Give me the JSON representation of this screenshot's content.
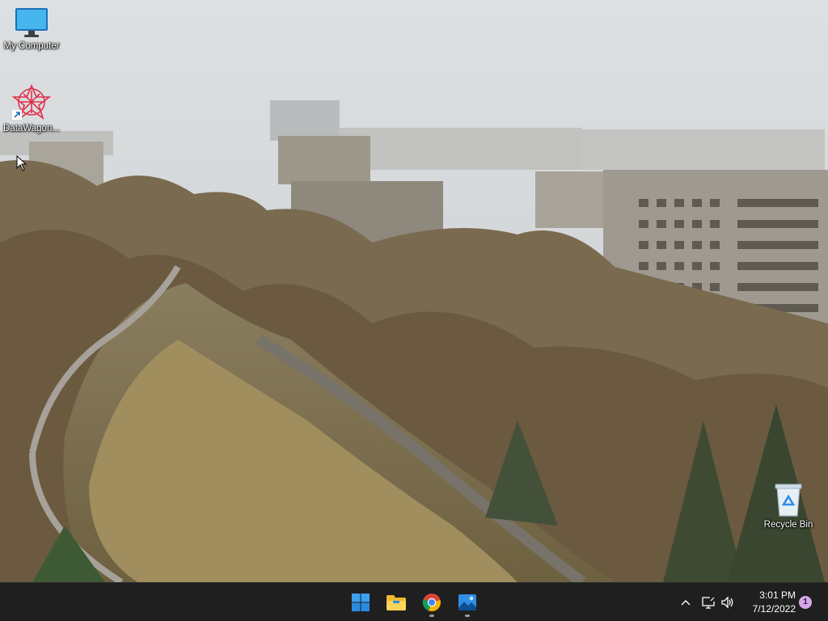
{
  "desktop": {
    "icons": [
      {
        "label": "My Computer",
        "icon": "monitor-icon"
      },
      {
        "label": "DataWagon...",
        "icon": "datawagon-logo-icon"
      },
      {
        "label": "Recycle Bin",
        "icon": "recycle-bin-icon"
      }
    ]
  },
  "taskbar": {
    "apps": [
      {
        "name": "Start",
        "icon": "windows-logo-icon"
      },
      {
        "name": "File Explorer",
        "icon": "folder-icon"
      },
      {
        "name": "Google Chrome",
        "icon": "chrome-icon"
      },
      {
        "name": "Photos",
        "icon": "photos-icon"
      }
    ],
    "tray": {
      "icons": [
        "chevron-up-icon",
        "network-icon",
        "volume-icon"
      ],
      "time": "3:01 PM",
      "date": "7/12/2022",
      "notification_count": "1"
    }
  },
  "colors": {
    "taskbar_bg": "#1f1f1f",
    "windows_blue": "#2f8ee6",
    "notification_badge": "#d7a6e8"
  }
}
